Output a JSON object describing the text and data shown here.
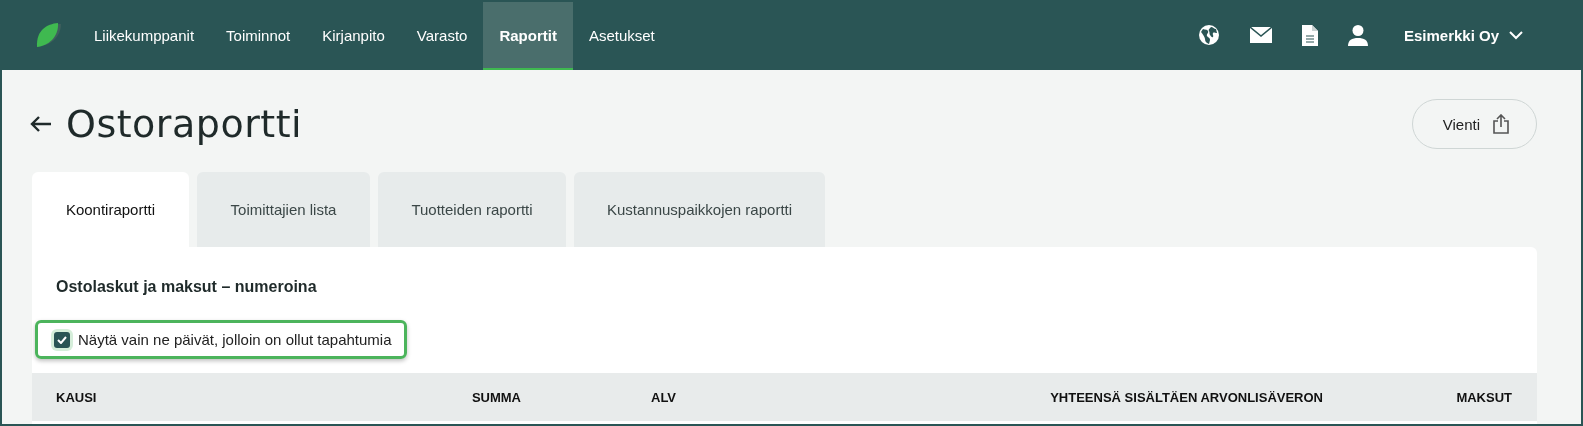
{
  "nav": {
    "items": [
      {
        "label": "Liikekumppanit",
        "selected": false
      },
      {
        "label": "Toiminnot",
        "selected": false
      },
      {
        "label": "Kirjanpito",
        "selected": false
      },
      {
        "label": "Varasto",
        "selected": false
      },
      {
        "label": "Raportit",
        "selected": true
      },
      {
        "label": "Asetukset",
        "selected": false
      }
    ],
    "account": "Esimerkki Oy"
  },
  "page": {
    "title": "Ostoraportti",
    "export_button": "Vienti"
  },
  "tabs": [
    {
      "label": "Koontiraportti",
      "selected": true
    },
    {
      "label": "Toimittajien lista",
      "selected": false
    },
    {
      "label": "Tuotteiden raportti",
      "selected": false
    },
    {
      "label": "Kustannuspaikkojen raportti",
      "selected": false
    }
  ],
  "report": {
    "heading": "Ostolaskut ja maksut – numeroina",
    "filter": {
      "label": "Näytä vain ne päivät, jolloin on ollut tapahtumia",
      "checked": true
    },
    "table": {
      "columns": [
        "KAUSI",
        "SUMMA",
        "ALV",
        "YHTEENSÄ SISÄLTÄEN ARVONLISÄVERON",
        "MAKSUT"
      ]
    }
  }
}
